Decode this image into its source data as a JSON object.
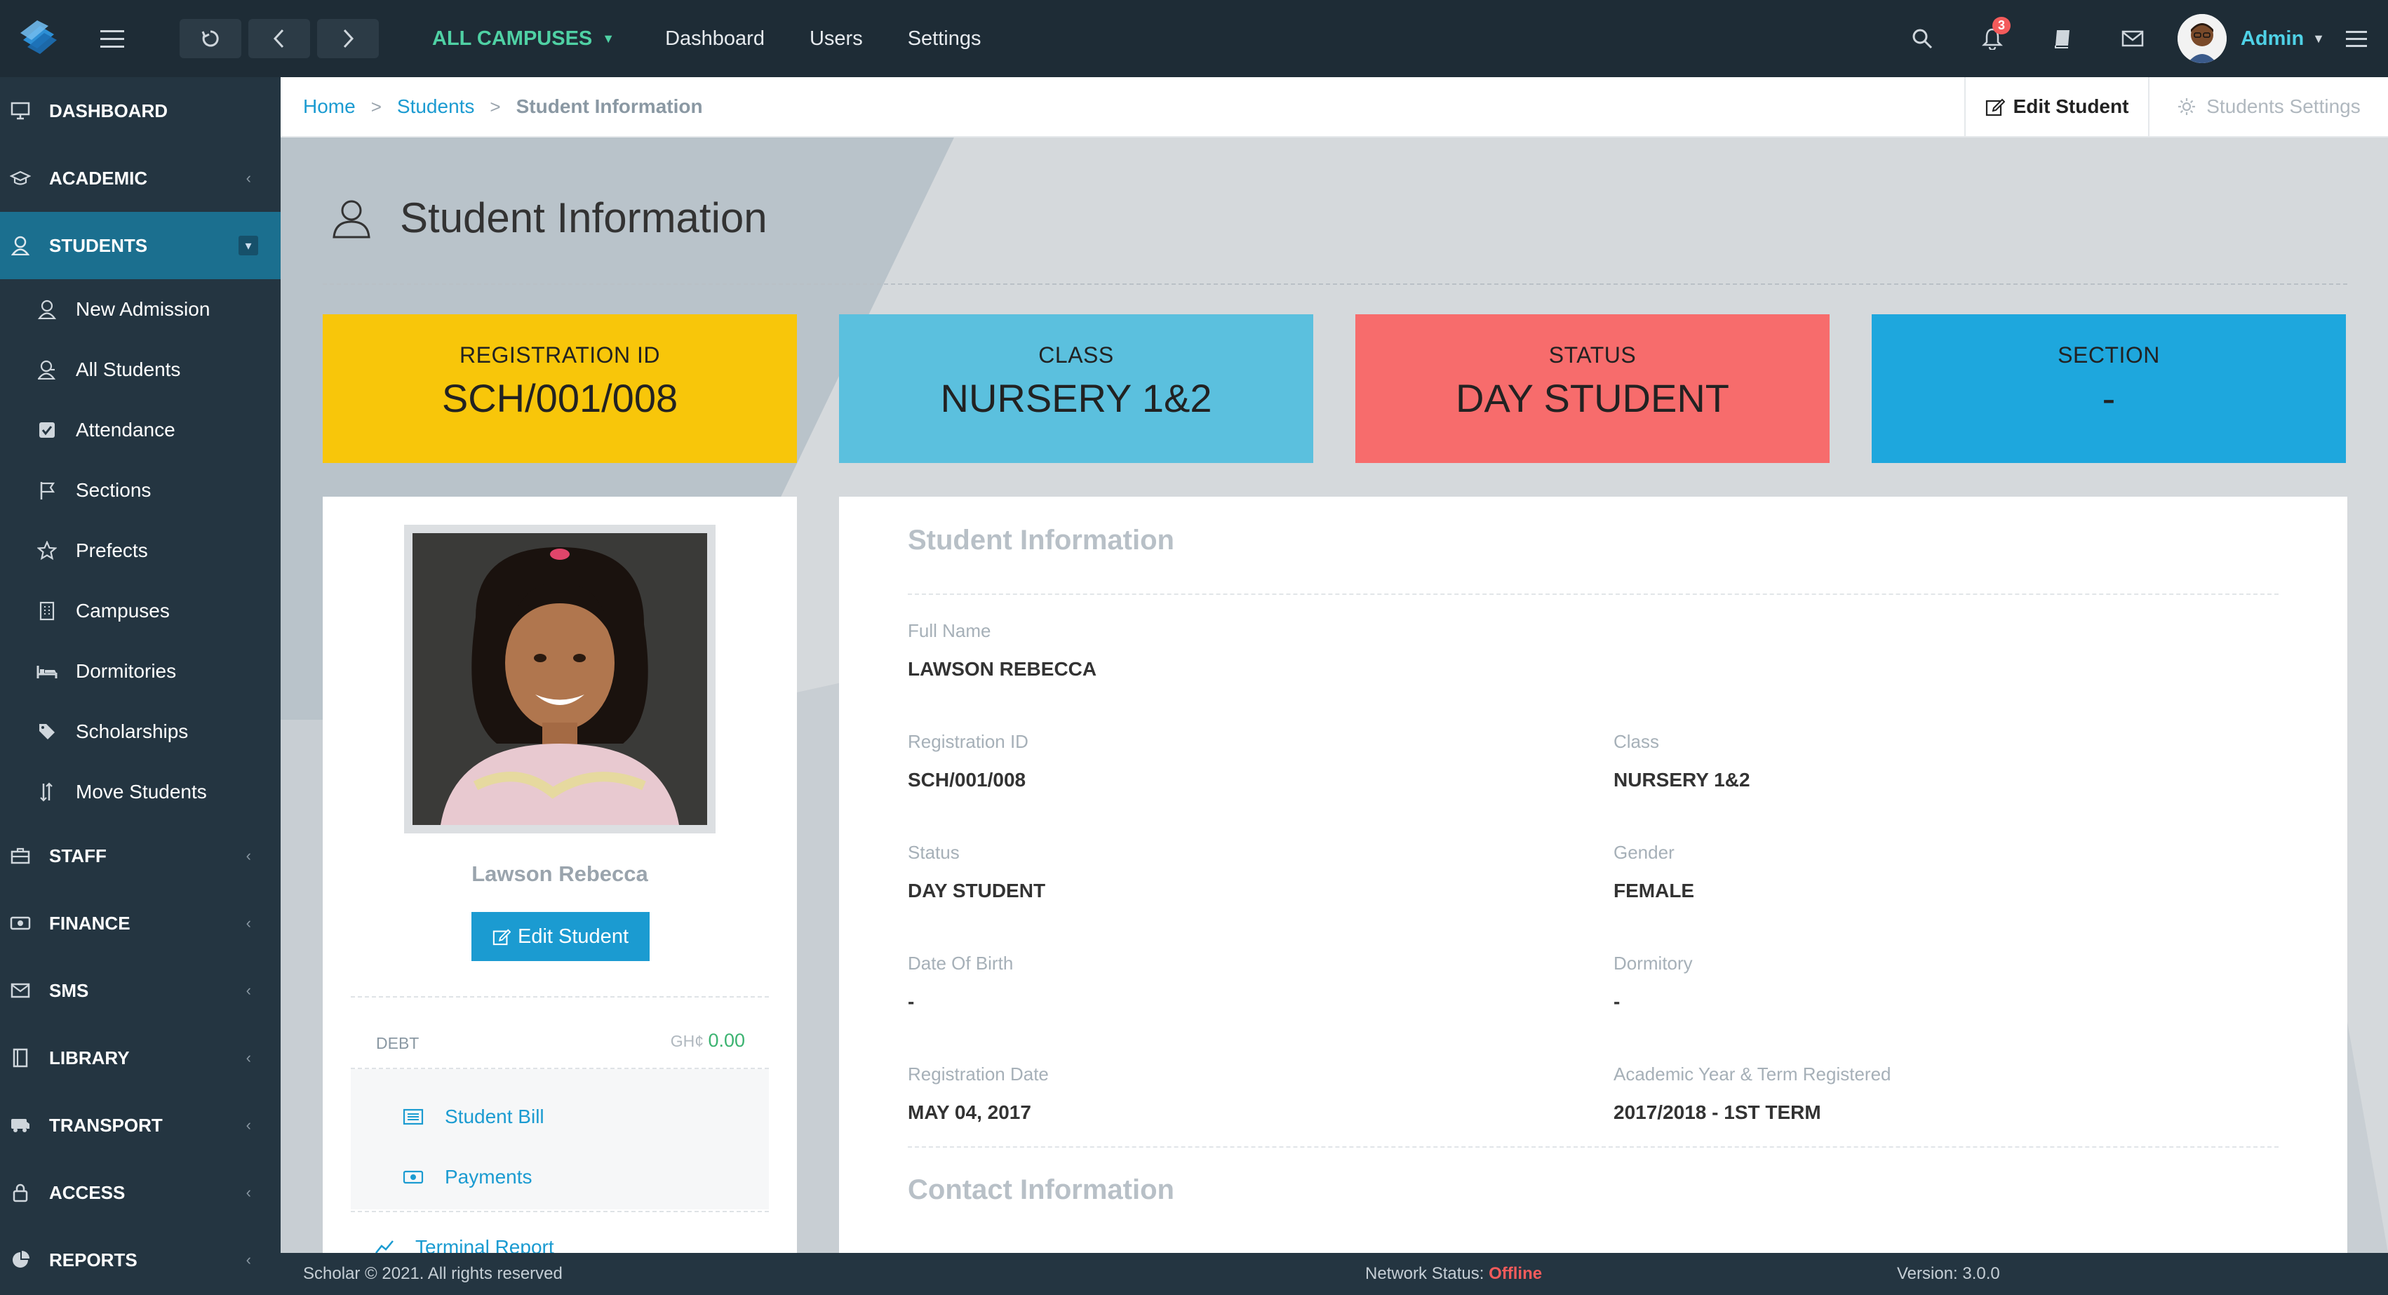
{
  "topbar": {
    "campus": "ALL CAMPUSES",
    "nav": [
      "Dashboard",
      "Users",
      "Settings"
    ],
    "notifications_count": "3",
    "user": "Admin"
  },
  "sidebar": {
    "items": [
      {
        "label": "DASHBOARD",
        "icon": "monitor-icon"
      },
      {
        "label": "ACADEMIC",
        "icon": "graduation-cap-icon"
      },
      {
        "label": "STUDENTS",
        "icon": "user-icon"
      },
      {
        "label": "STAFF",
        "icon": "briefcase-icon"
      },
      {
        "label": "FINANCE",
        "icon": "money-icon"
      },
      {
        "label": "SMS",
        "icon": "envelope-icon"
      },
      {
        "label": "LIBRARY",
        "icon": "book-icon"
      },
      {
        "label": "TRANSPORT",
        "icon": "bus-icon"
      },
      {
        "label": "ACCESS",
        "icon": "lock-icon"
      },
      {
        "label": "REPORTS",
        "icon": "pie-chart-icon"
      }
    ],
    "students_sub": [
      {
        "label": "New Admission",
        "icon": "user-plus-icon"
      },
      {
        "label": "All Students",
        "icon": "users-icon"
      },
      {
        "label": "Attendance",
        "icon": "check-square-icon"
      },
      {
        "label": "Sections",
        "icon": "flag-icon"
      },
      {
        "label": "Prefects",
        "icon": "star-icon"
      },
      {
        "label": "Campuses",
        "icon": "building-icon"
      },
      {
        "label": "Dormitories",
        "icon": "bed-icon"
      },
      {
        "label": "Scholarships",
        "icon": "tag-icon"
      },
      {
        "label": "Move Students",
        "icon": "sort-icon"
      }
    ]
  },
  "breadcrumb": {
    "home": "Home",
    "students": "Students",
    "current": "Student Information",
    "edit_button": "Edit Student",
    "settings_button": "Students Settings"
  },
  "page": {
    "title": "Student Information"
  },
  "stats": [
    {
      "label": "REGISTRATION ID",
      "value": "SCH/001/008",
      "color": "#f8c60a"
    },
    {
      "label": "CLASS",
      "value": "NURSERY 1&2",
      "color": "#5bc0de"
    },
    {
      "label": "STATUS",
      "value": "DAY STUDENT",
      "color": "#f76c6c"
    },
    {
      "label": "SECTION",
      "value": "-",
      "color": "#1ea7dd"
    }
  ],
  "profile": {
    "name": "Lawson Rebecca",
    "edit_button": "Edit Student",
    "debt_label": "DEBT",
    "debt_currency": "GH¢",
    "debt_amount": "0.00",
    "links": [
      "Student Bill",
      "Payments",
      "Terminal Report"
    ]
  },
  "info": {
    "section_title": "Student Information",
    "full_name_label": "Full Name",
    "full_name": "LAWSON REBECCA",
    "reg_id_label": "Registration ID",
    "reg_id": "SCH/001/008",
    "class_label": "Class",
    "class": "NURSERY 1&2",
    "status_label": "Status",
    "status": "DAY STUDENT",
    "gender_label": "Gender",
    "gender": "FEMALE",
    "dob_label": "Date Of Birth",
    "dob": "-",
    "dorm_label": "Dormitory",
    "dorm": "-",
    "reg_date_label": "Registration Date",
    "reg_date": "MAY 04, 2017",
    "acad_label": "Academic Year & Term Registered",
    "acad": "2017/2018 - 1ST TERM",
    "contact_title": "Contact Information"
  },
  "footer": {
    "copyright": "Scholar © 2021. All rights reserved",
    "network_label": "Network Status:",
    "network_value": "Offline",
    "version": "Version: 3.0.0"
  }
}
